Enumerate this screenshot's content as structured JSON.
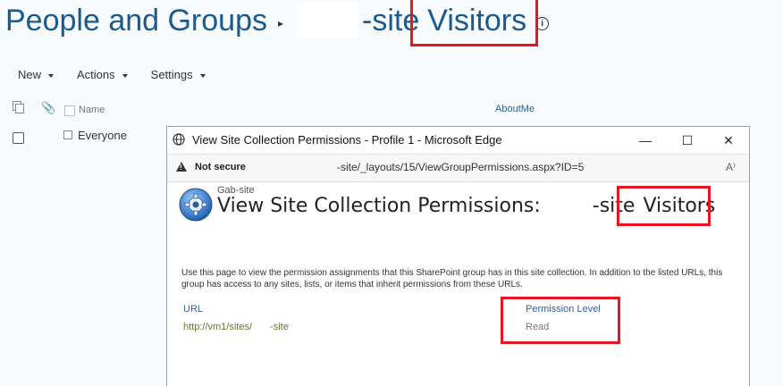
{
  "header": {
    "title_prefix": "People and Groups",
    "breadcrumb_sep": "▸",
    "title_site": "-site",
    "title_group": "Visitors",
    "info_glyph": "i"
  },
  "toolbar": {
    "new_label": "New",
    "actions_label": "Actions",
    "settings_label": "Settings"
  },
  "list": {
    "columns": {
      "name": "Name",
      "aboutme": "AboutMe"
    },
    "rows": [
      {
        "name": "Everyone"
      }
    ]
  },
  "popup": {
    "window_title": "View Site Collection Permissions - Profile 1 - Microsoft Edge",
    "controls": {
      "minimize": "—",
      "maximize": "☐",
      "close": "✕"
    },
    "address": {
      "security_label": "Not secure",
      "url": "-site/_layouts/15/ViewGroupPermissions.aspx?ID=5",
      "read_aloud_glyph": "A⁾"
    },
    "site_name": "Gab-site",
    "heading_prefix": "View Site Collection Permissions:",
    "heading_site": "-site",
    "heading_group": "Visitors",
    "intro": "Use this page to view the permission assignments that this SharePoint group has in this site collection. In addition to the listed URLs, this group has access to any sites, lists, or items that inherit permissions from these URLs.",
    "table": {
      "headers": {
        "url": "URL",
        "permission": "Permission Level"
      },
      "rows": [
        {
          "url_prefix": "http://vm1/sites/",
          "url_suffix": "-site",
          "permission": "Read"
        }
      ]
    }
  },
  "colors": {
    "highlight": "#e8141f",
    "title_blue": "#1b5a8f",
    "link_blue": "#2b5fa6"
  }
}
